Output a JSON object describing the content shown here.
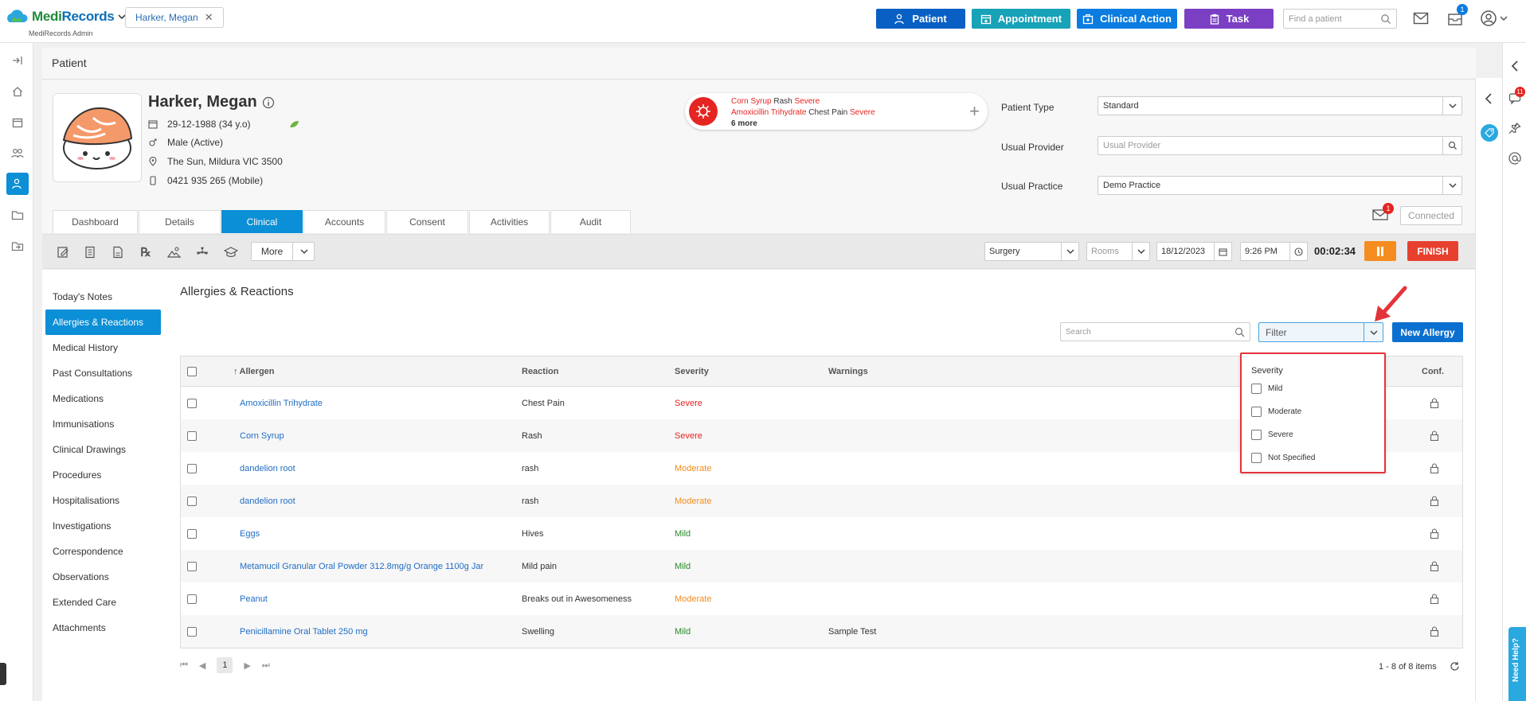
{
  "app": {
    "logo_part1": "Medi",
    "logo_part2": "Records",
    "logo_sub": "MediRecords Admin",
    "patient_chip": "Harker, Megan"
  },
  "top_actions": {
    "patient": "Patient",
    "appointment": "Appointment",
    "clinical_action": "Clinical Action",
    "task": "Task",
    "find_placeholder": "Find a patient",
    "notification_count": "1"
  },
  "page": {
    "title": "Patient"
  },
  "patient": {
    "name": "Harker, Megan",
    "dob": "29-12-1988 (34 y.o)",
    "gender": "Male (Active)",
    "address": "The Sun, Mildura VIC 3500",
    "phone": "0421 935 265 (Mobile)"
  },
  "allergy_card": {
    "line1_allergen": "Corn Syrup",
    "line1_reaction": "Rash",
    "line1_severity": "Severe",
    "line2_allergen": "Amoxicillin Trihydrate",
    "line2_reaction": "Chest Pain",
    "line2_severity": "Severe",
    "more": "6 more"
  },
  "fields": {
    "patient_type_label": "Patient Type",
    "patient_type_value": "Standard",
    "usual_provider_label": "Usual Provider",
    "usual_provider_placeholder": "Usual Provider",
    "usual_practice_label": "Usual Practice",
    "usual_practice_value": "Demo Practice"
  },
  "tabs": [
    "Dashboard",
    "Details",
    "Clinical",
    "Accounts",
    "Consent",
    "Activities",
    "Audit"
  ],
  "connection": {
    "status": "Connected",
    "message_count": "1"
  },
  "toolbar": {
    "more": "More",
    "surgery": "Surgery",
    "rooms": "Rooms",
    "date": "18/12/2023",
    "time": "9:26 PM",
    "timer": "00:02:34",
    "finish": "FINISH"
  },
  "side_nav": [
    "Today's Notes",
    "Allergies & Reactions",
    "Medical History",
    "Past Consultations",
    "Medications",
    "Immunisations",
    "Clinical Drawings",
    "Procedures",
    "Hospitalisations",
    "Investigations",
    "Correspondence",
    "Observations",
    "Extended Care",
    "Attachments"
  ],
  "section": {
    "title": "Allergies & Reactions",
    "search_placeholder": "Search",
    "filter_placeholder": "Filter",
    "new_button": "New Allergy"
  },
  "grid": {
    "headers": {
      "allergen": "Allergen",
      "reaction": "Reaction",
      "severity": "Severity",
      "warnings": "Warnings",
      "conf": "Conf."
    },
    "rows": [
      {
        "allergen": "Amoxicillin Trihydrate",
        "reaction": "Chest Pain",
        "severity": "Severe",
        "warnings": ""
      },
      {
        "allergen": "Corn Syrup",
        "reaction": "Rash",
        "severity": "Severe",
        "warnings": ""
      },
      {
        "allergen": "dandelion root",
        "reaction": "rash",
        "severity": "Moderate",
        "warnings": ""
      },
      {
        "allergen": "dandelion root",
        "reaction": "rash",
        "severity": "Moderate",
        "warnings": ""
      },
      {
        "allergen": "Eggs",
        "reaction": "Hives",
        "severity": "Mild",
        "warnings": ""
      },
      {
        "allergen": "Metamucil Granular Oral Powder 312.8mg/g Orange 1100g Jar",
        "reaction": "Mild pain",
        "severity": "Mild",
        "warnings": ""
      },
      {
        "allergen": "Peanut",
        "reaction": "Breaks out in Awesomeness",
        "severity": "Moderate",
        "warnings": ""
      },
      {
        "allergen": "Penicillamine Oral Tablet 250 mg",
        "reaction": "Swelling",
        "severity": "Mild",
        "warnings": "Sample Test"
      }
    ]
  },
  "pager": {
    "current_page": "1",
    "info": "1 - 8 of 8 items"
  },
  "filter_dropdown": {
    "title": "Severity",
    "options": [
      "Mild",
      "Moderate",
      "Severe",
      "Not Specified"
    ]
  },
  "right_rail": {
    "badge": "11"
  },
  "help": {
    "label": "Need Help?"
  },
  "colors": {
    "primary": "#0b8fd6",
    "patient_btn": "#0a5fc4",
    "appointment_btn": "#17a2b8",
    "clinical_btn": "#0b7ce0",
    "task_btn": "#7b3fc4",
    "severe": "#e52521",
    "moderate": "#f28c1a",
    "mild": "#2a8a2a"
  }
}
